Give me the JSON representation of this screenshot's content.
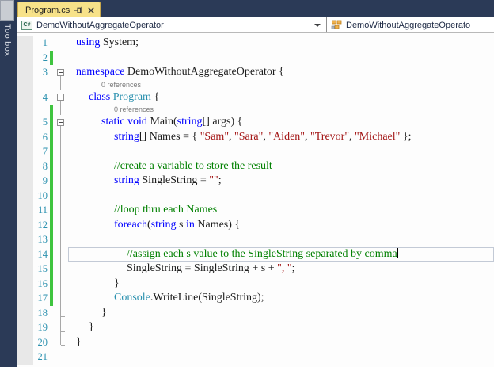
{
  "colors": {
    "titlebar_navy": "#2b3a57",
    "tab_yellow": "#f7e289",
    "change_bar_green": "#3fc43f",
    "keyword_blue": "#0000ff",
    "type_teal": "#2b91af",
    "string_red": "#a31515",
    "comment_green": "#008000",
    "line_number_teal": "#2b91af"
  },
  "sidebar": {
    "toolbox_label": "Toolbox"
  },
  "tab_bar": {
    "tabs": [
      {
        "label": "Program.cs",
        "active": true,
        "pinned": false
      }
    ]
  },
  "nav_bar": {
    "left_dropdown": {
      "value": "DemoWithoutAggregateOperator",
      "icon": "csharp-project-icon",
      "csharp_glyph": "C#"
    },
    "right_dropdown": {
      "value": "DemoWithoutAggregateOperato",
      "icon": "class-icon"
    }
  },
  "editor": {
    "codelens_label": "0 references",
    "lines": [
      {
        "n": "1",
        "ind": 0,
        "ol": "",
        "bar": false,
        "toks": [
          [
            "kw",
            "using"
          ],
          [
            "pl",
            " System;"
          ]
        ]
      },
      {
        "n": "2",
        "ind": 0,
        "ol": "",
        "bar": true,
        "toks": []
      },
      {
        "n": "3",
        "ind": 0,
        "ol": "box",
        "bar": false,
        "toks": [
          [
            "kw",
            "namespace"
          ],
          [
            "pl",
            " DemoWithoutAggregateOperator {"
          ]
        ]
      },
      {
        "cl": true,
        "ind": 2,
        "ol": "line",
        "bar": false,
        "label": "0 references"
      },
      {
        "n": "4",
        "ind": 1,
        "ol": "box",
        "bar": false,
        "toks": [
          [
            "kw",
            "class"
          ],
          [
            "pl",
            " "
          ],
          [
            "ty",
            "Program"
          ],
          [
            "pl",
            " {"
          ]
        ]
      },
      {
        "cl": true,
        "ind": 3,
        "ol": "line",
        "bar": true,
        "label": "0 references"
      },
      {
        "n": "5",
        "ind": 2,
        "ol": "box",
        "bar": true,
        "toks": [
          [
            "kw",
            "static"
          ],
          [
            "pl",
            " "
          ],
          [
            "kw",
            "void"
          ],
          [
            "pl",
            " Main("
          ],
          [
            "kw",
            "string"
          ],
          [
            "pl",
            "[] args) {"
          ]
        ]
      },
      {
        "n": "6",
        "ind": 3,
        "ol": "line",
        "bar": true,
        "toks": [
          [
            "kw",
            "string"
          ],
          [
            "pl",
            "[] Names = { "
          ],
          [
            "st",
            "\"Sam\""
          ],
          [
            "pl",
            ", "
          ],
          [
            "st",
            "\"Sara\""
          ],
          [
            "pl",
            ", "
          ],
          [
            "st",
            "\"Aiden\""
          ],
          [
            "pl",
            ", "
          ],
          [
            "st",
            "\"Trevor\""
          ],
          [
            "pl",
            ", "
          ],
          [
            "st",
            "\"Michael\""
          ],
          [
            "pl",
            " };"
          ]
        ]
      },
      {
        "n": "7",
        "ind": 0,
        "ol": "line",
        "bar": true,
        "toks": []
      },
      {
        "n": "8",
        "ind": 3,
        "ol": "line",
        "bar": true,
        "toks": [
          [
            "cm",
            "//create a variable to store the result"
          ]
        ]
      },
      {
        "n": "9",
        "ind": 3,
        "ol": "line",
        "bar": true,
        "toks": [
          [
            "kw",
            "string"
          ],
          [
            "pl",
            " SingleString = "
          ],
          [
            "st",
            "\"\""
          ],
          [
            "pl",
            ";"
          ]
        ]
      },
      {
        "n": "10",
        "ind": 0,
        "ol": "line",
        "bar": true,
        "toks": []
      },
      {
        "n": "11",
        "ind": 3,
        "ol": "line",
        "bar": true,
        "toks": [
          [
            "cm",
            "//loop thru each Names"
          ]
        ]
      },
      {
        "n": "12",
        "ind": 3,
        "ol": "line",
        "bar": true,
        "toks": [
          [
            "kw",
            "foreach"
          ],
          [
            "pl",
            "("
          ],
          [
            "kw",
            "string"
          ],
          [
            "pl",
            " s "
          ],
          [
            "kw",
            "in"
          ],
          [
            "pl",
            " Names) {"
          ]
        ]
      },
      {
        "n": "13",
        "ind": 0,
        "ol": "line",
        "bar": true,
        "toks": []
      },
      {
        "n": "14",
        "ind": 4,
        "ol": "line",
        "bar": true,
        "current": true,
        "caret": true,
        "toks": [
          [
            "cm",
            "//assign each s value to the SingleString separated by comma"
          ]
        ]
      },
      {
        "n": "15",
        "ind": 4,
        "ol": "line",
        "bar": true,
        "toks": [
          [
            "pl",
            "SingleString = SingleString + s + "
          ],
          [
            "st",
            "\", \""
          ],
          [
            "pl",
            ";"
          ]
        ]
      },
      {
        "n": "16",
        "ind": 3,
        "ol": "line",
        "bar": true,
        "toks": [
          [
            "pl",
            "}"
          ]
        ]
      },
      {
        "n": "17",
        "ind": 3,
        "ol": "line",
        "bar": true,
        "toks": [
          [
            "ty",
            "Console"
          ],
          [
            "pl",
            ".WriteLine(SingleString);"
          ]
        ]
      },
      {
        "n": "18",
        "ind": 2,
        "ol": "tick",
        "bar": false,
        "toks": [
          [
            "pl",
            "}"
          ]
        ]
      },
      {
        "n": "19",
        "ind": 1,
        "ol": "tick",
        "bar": false,
        "toks": [
          [
            "pl",
            "}"
          ]
        ]
      },
      {
        "n": "20",
        "ind": 0,
        "ol": "corner",
        "bar": false,
        "toks": [
          [
            "pl",
            "}"
          ]
        ]
      },
      {
        "n": "21",
        "ind": 0,
        "ol": "",
        "bar": false,
        "toks": []
      }
    ]
  }
}
